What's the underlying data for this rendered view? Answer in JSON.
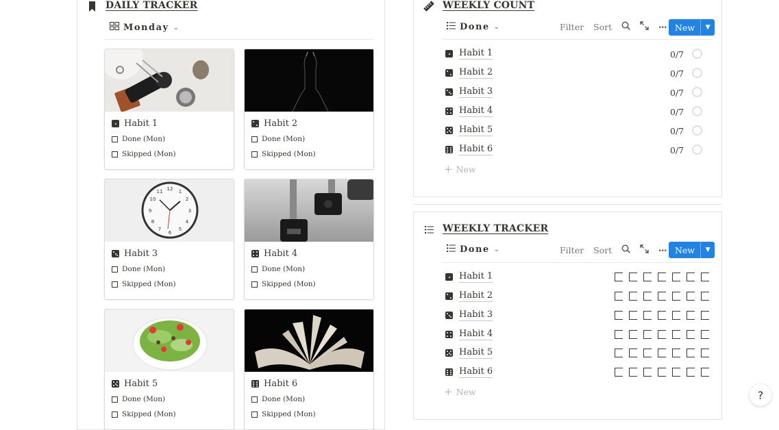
{
  "colors": {
    "accent": "#2383e2",
    "text": "#37352f",
    "muted": "#787774",
    "border": "#e3e2e0"
  },
  "daily_tracker": {
    "title": "DAILY TRACKER",
    "icon": "bookmark-icon",
    "view_label": "Monday",
    "view_icon": "gallery-icon",
    "cards": [
      {
        "name": "Habit 1",
        "props": [
          "Done (Mon)",
          "Skipped (Mon)"
        ]
      },
      {
        "name": "Habit 2",
        "props": [
          "Done (Mon)",
          "Skipped (Mon)"
        ]
      },
      {
        "name": "Habit 3",
        "props": [
          "Done (Mon)",
          "Skipped (Mon)"
        ]
      },
      {
        "name": "Habit 4",
        "props": [
          "Done (Mon)",
          "Skipped (Mon)"
        ]
      },
      {
        "name": "Habit 5",
        "props": [
          "Done (Mon)",
          "Skipped (Mon)"
        ]
      },
      {
        "name": "Habit 6",
        "props": [
          "Done (Mon)",
          "Skipped (Mon)"
        ]
      }
    ]
  },
  "weekly_count": {
    "title": "WEEKLY COUNT",
    "icon": "ruler-icon",
    "view_label": "Done",
    "view_icon": "list-icon",
    "toolbar": {
      "filter": "Filter",
      "sort": "Sort",
      "new": "New"
    },
    "rows": [
      {
        "name": "Habit 1",
        "count": "0/7",
        "progress": 0
      },
      {
        "name": "Habit 2",
        "count": "0/7",
        "progress": 0
      },
      {
        "name": "Habit 3",
        "count": "0/7",
        "progress": 0
      },
      {
        "name": "Habit 4",
        "count": "0/7",
        "progress": 0
      },
      {
        "name": "Habit 5",
        "count": "0/7",
        "progress": 0
      },
      {
        "name": "Habit 6",
        "count": "0/7",
        "progress": 0
      }
    ],
    "new_row": "New"
  },
  "weekly_tracker": {
    "title": "WEEKLY TRACKER",
    "icon": "list-icon",
    "view_label": "Done",
    "view_icon": "list-icon",
    "toolbar": {
      "filter": "Filter",
      "sort": "Sort",
      "new": "New"
    },
    "rows": [
      {
        "name": "Habit 1",
        "days_checked": [
          false,
          false,
          false,
          false,
          false,
          false,
          false
        ]
      },
      {
        "name": "Habit 2",
        "days_checked": [
          false,
          false,
          false,
          false,
          false,
          false,
          false
        ]
      },
      {
        "name": "Habit 3",
        "days_checked": [
          false,
          false,
          false,
          false,
          false,
          false,
          false
        ]
      },
      {
        "name": "Habit 4",
        "days_checked": [
          false,
          false,
          false,
          false,
          false,
          false,
          false
        ]
      },
      {
        "name": "Habit 5",
        "days_checked": [
          false,
          false,
          false,
          false,
          false,
          false,
          false
        ]
      },
      {
        "name": "Habit 6",
        "days_checked": [
          false,
          false,
          false,
          false,
          false,
          false,
          false
        ]
      }
    ],
    "new_row": "New"
  },
  "help": {
    "label": "?"
  }
}
